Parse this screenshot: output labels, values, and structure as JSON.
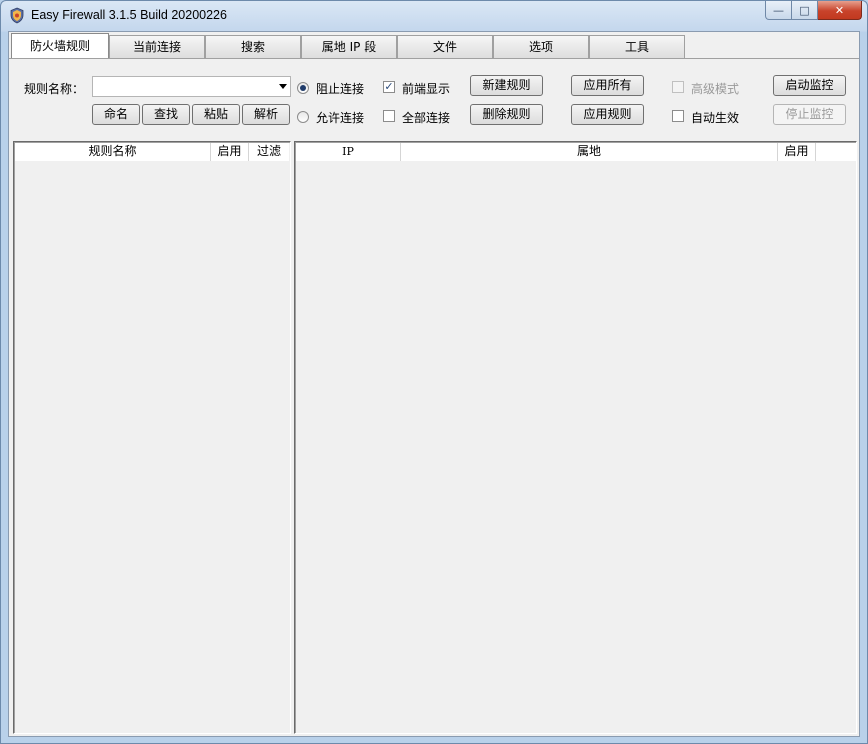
{
  "window": {
    "title": "Easy Firewall 3.1.5 Build 20200226",
    "minimize": "—",
    "maximize": "□",
    "close": "✕"
  },
  "tabs": [
    "防火墙规则",
    "当前连接",
    "搜索",
    "属地 IP 段",
    "文件",
    "选项",
    "工具"
  ],
  "form": {
    "rule_name_label": "规则名称：",
    "rule_name_value": "",
    "rename": "命名",
    "find": "查找",
    "paste": "粘贴",
    "parse": "解析",
    "block": "阻止连接",
    "allow": "允许连接",
    "front_display": "前端显示",
    "all_connections": "全部连接",
    "new_rule": "新建规则",
    "delete_rule": "删除规则",
    "apply_all": "应用所有",
    "apply_rule": "应用规则",
    "advanced_mode": "高级模式",
    "auto_effect": "自动生效",
    "start_monitor": "启动监控",
    "stop_monitor": "停止监控"
  },
  "state": {
    "block_selected": true,
    "allow_selected": false,
    "front_display_checked": true,
    "all_connections_checked": false,
    "advanced_mode_checked": false,
    "auto_effect_checked": false
  },
  "rules_list": {
    "columns": [
      "规则名称",
      "启用",
      "过滤"
    ],
    "rows": []
  },
  "ip_list": {
    "columns": [
      "IP",
      "属地",
      "启用"
    ],
    "rows": []
  },
  "colors": {
    "title_bg": "#c4d7ed",
    "client_bg": "#f0f0f0",
    "close_button": "#c8432b"
  },
  "icons": {
    "app": "firewall-shield-icon"
  }
}
